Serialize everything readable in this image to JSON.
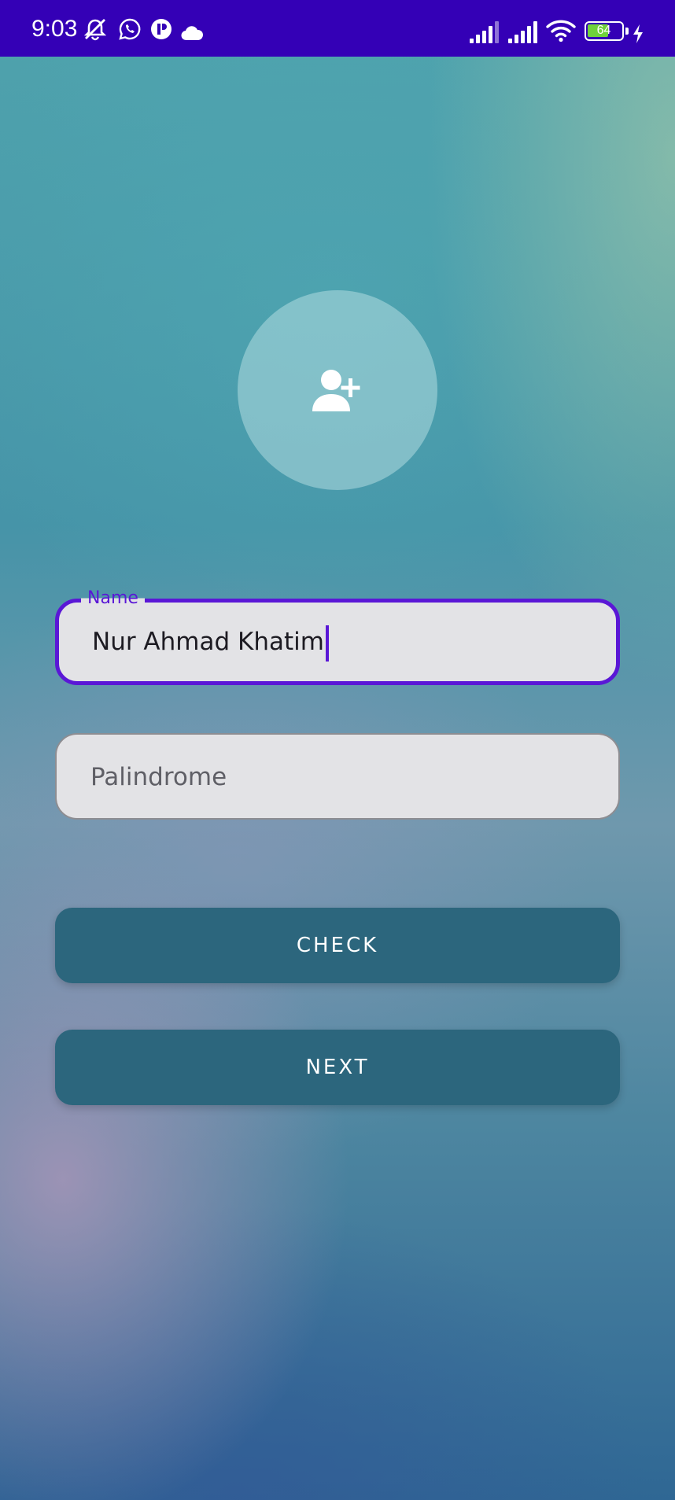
{
  "status_bar": {
    "time": "9:03",
    "battery_level": "64",
    "icons": [
      "muted-bell-icon",
      "whatsapp-icon",
      "app-notification-icon",
      "cloud-icon",
      "signal-icon",
      "signal-icon",
      "wifi-icon",
      "battery-icon",
      "charging-bolt-icon"
    ],
    "background_color": "#3400b6"
  },
  "avatar": {
    "icon": "add-user-icon"
  },
  "form": {
    "name_field": {
      "label": "Name",
      "value": "Nur Ahmad Khatim",
      "focused": true,
      "accent_color": "#5a17d6"
    },
    "palindrome_field": {
      "placeholder": "Palindrome",
      "value": ""
    }
  },
  "buttons": {
    "check_label": "CHECK",
    "next_label": "NEXT",
    "color": "#2c667d"
  }
}
